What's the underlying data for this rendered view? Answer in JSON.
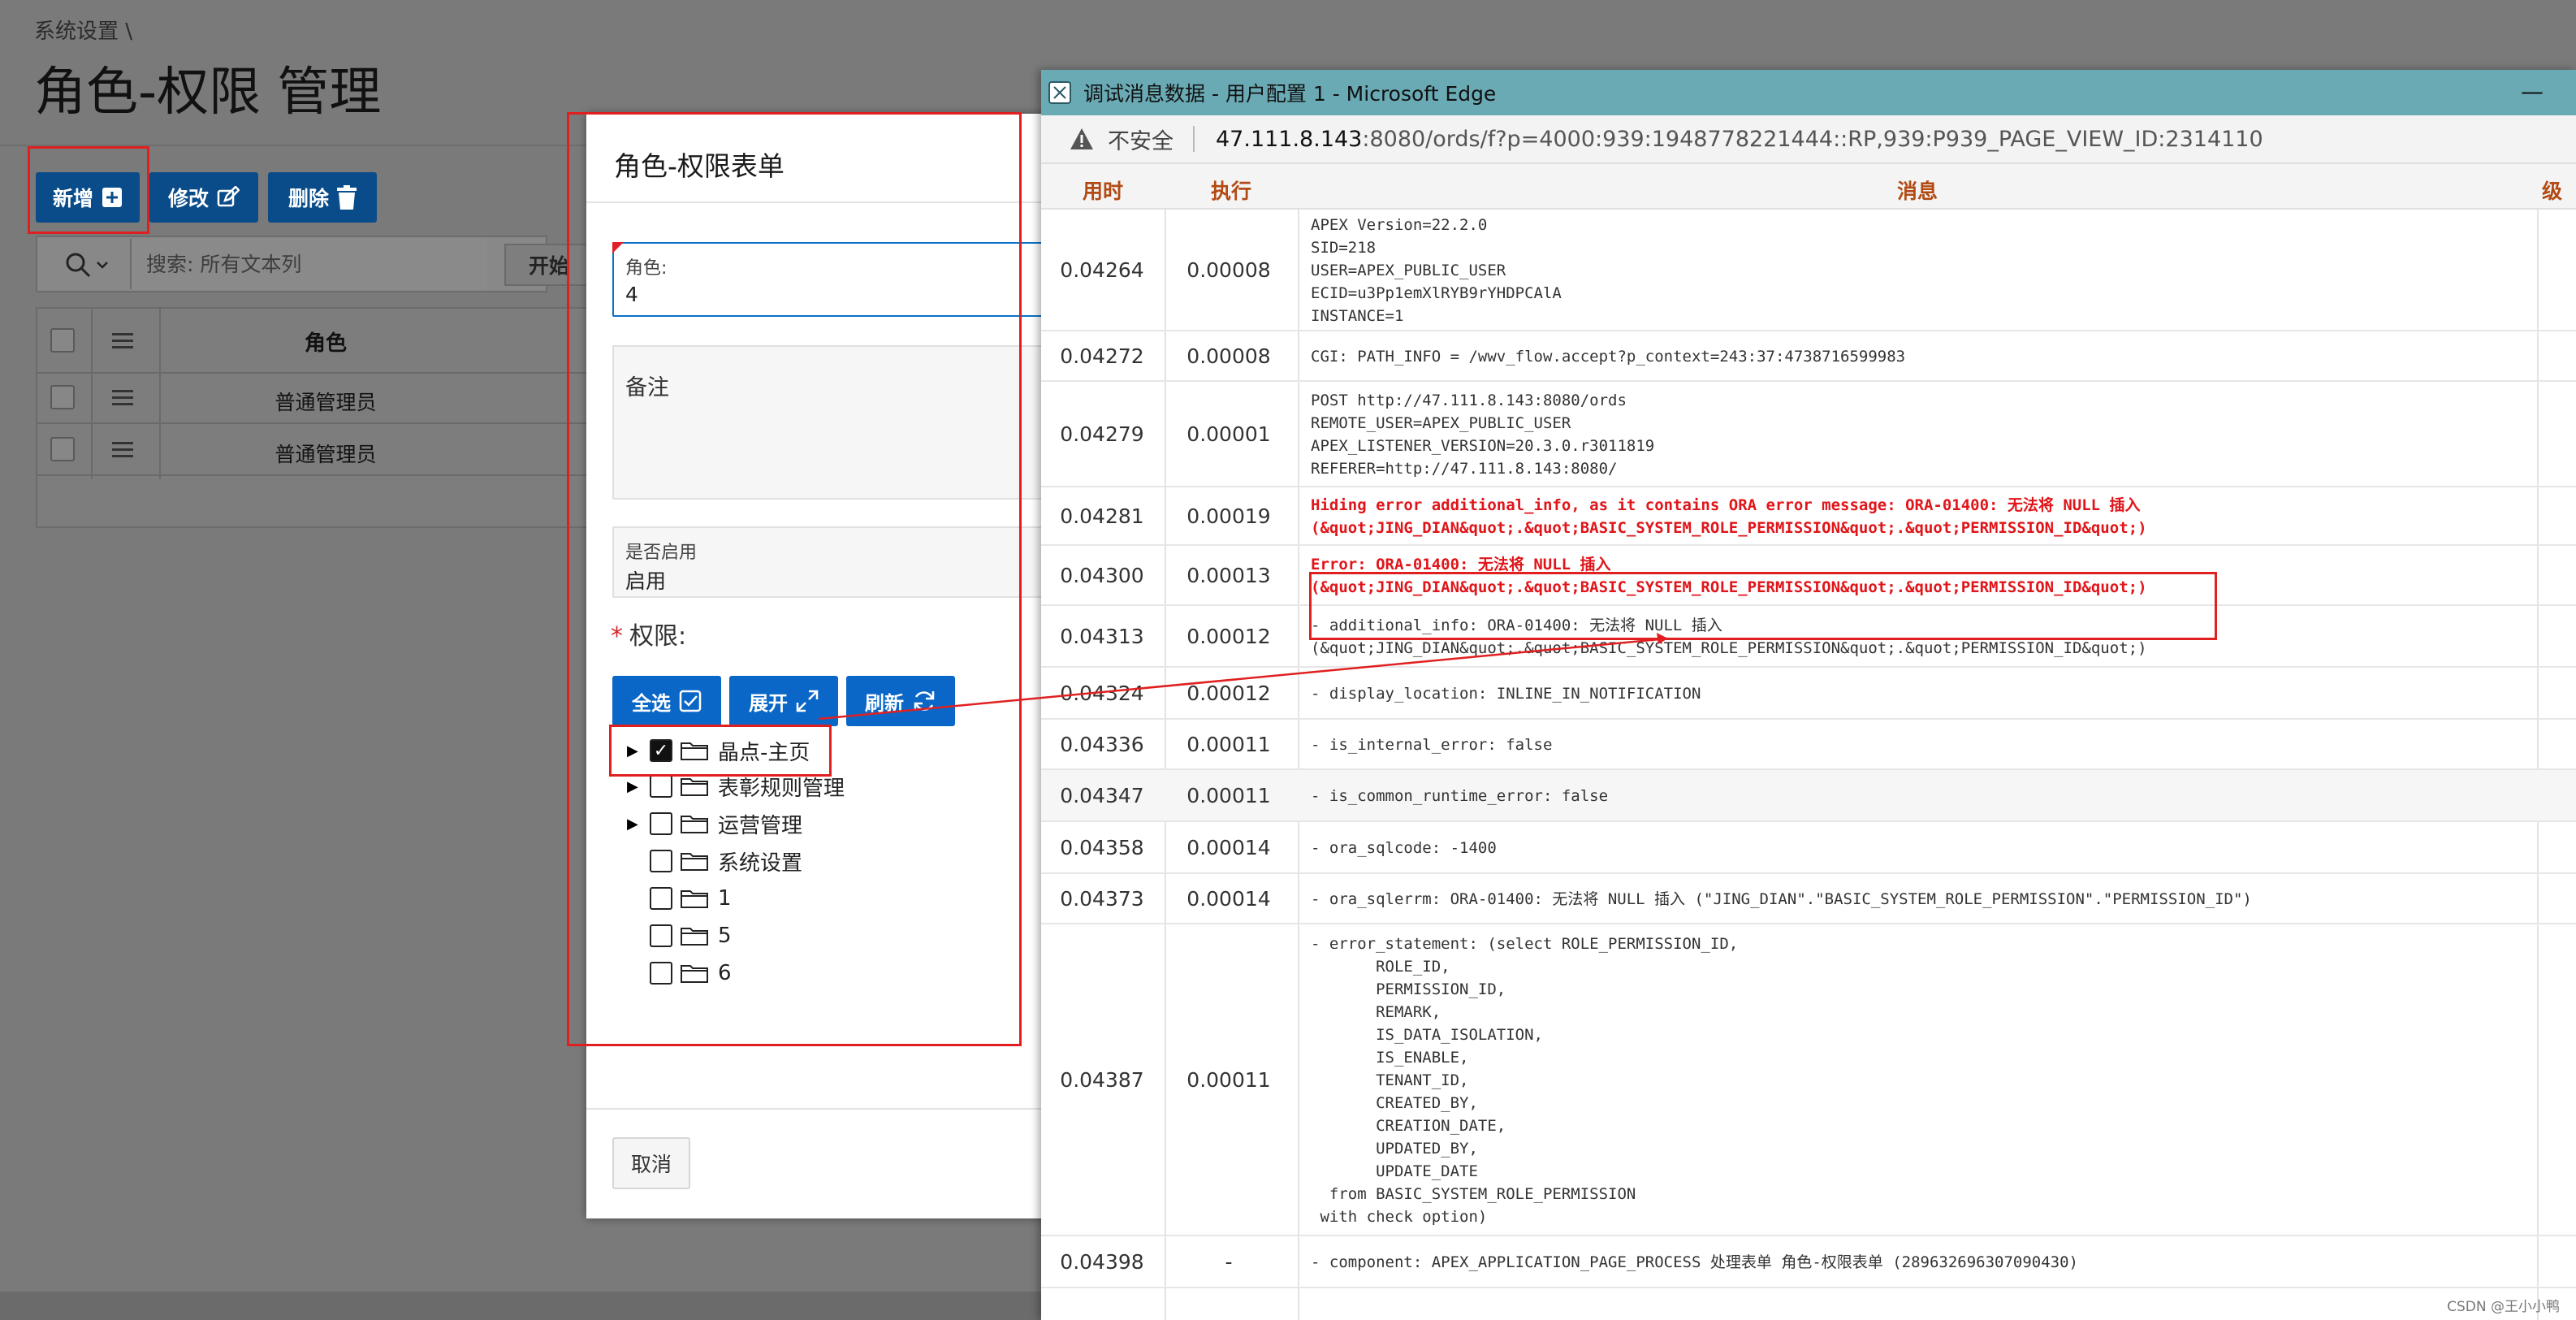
{
  "page": {
    "breadcrumb": "系统设置 \\",
    "title": "角色-权限 管理"
  },
  "toolbar": {
    "add_label": "新增",
    "edit_label": "修改",
    "delete_label": "删除"
  },
  "search": {
    "placeholder": "搜索: 所有文本列",
    "go_label": "开始"
  },
  "grid": {
    "column_role": "角色",
    "rows": [
      "普通管理员",
      "普通管理员"
    ]
  },
  "dialog": {
    "title": "角色-权限表单",
    "role_label": "角色:",
    "role_value": "4",
    "remark_label": "备注",
    "enabled_label": "是否启用",
    "enabled_value": "启用",
    "permission_label": "权限:",
    "select_all_label": "全选",
    "expand_label": "展开",
    "refresh_label": "刷新",
    "tree": [
      {
        "label": "晶点-主页",
        "checked": true,
        "expandable": true
      },
      {
        "label": "表彰规则管理",
        "checked": false,
        "expandable": true
      },
      {
        "label": "运营管理",
        "checked": false,
        "expandable": true
      },
      {
        "label": "系统设置",
        "checked": false,
        "expandable": false
      },
      {
        "label": "1",
        "checked": false,
        "expandable": false
      },
      {
        "label": "5",
        "checked": false,
        "expandable": false
      },
      {
        "label": "6",
        "checked": false,
        "expandable": false
      }
    ],
    "cancel_label": "取消"
  },
  "edge": {
    "window_title": "调试消息数据 - 用户配置 1 - Microsoft Edge",
    "insecure_label": "不安全",
    "url_host": "47.111.8.143",
    "url_rest": ":8080/ords/f?p=4000:939:1948778221444::RP,939:P939_PAGE_VIEW_ID:2314110",
    "columns": {
      "time": "用时",
      "exec": "执行",
      "message": "消息",
      "level": "级"
    },
    "rows": [
      {
        "time": "0.04264",
        "exec": "0.00008",
        "msg": "APEX Version=22.2.0\nSID=218\nUSER=APEX_PUBLIC_USER\nECID=u3Pp1emXlRYB9rYHDPCAlA\nINSTANCE=1",
        "err": false
      },
      {
        "time": "0.04272",
        "exec": "0.00008",
        "msg": "CGI: PATH_INFO = /wwv_flow.accept?p_context=243:37:4738716599983",
        "err": false
      },
      {
        "time": "0.04279",
        "exec": "0.00001",
        "msg": "POST http://47.111.8.143:8080/ords\nREMOTE_USER=APEX_PUBLIC_USER\nAPEX_LISTENER_VERSION=20.3.0.r3011819\nREFERER=http://47.111.8.143:8080/",
        "err": false
      },
      {
        "time": "0.04281",
        "exec": "0.00019",
        "msg": "Hiding error additional_info, as it contains ORA error message: ORA-01400: 无法将 NULL 插入\n(&quot;JING_DIAN&quot;.&quot;BASIC_SYSTEM_ROLE_PERMISSION&quot;.&quot;PERMISSION_ID&quot;)",
        "err": true
      },
      {
        "time": "0.04300",
        "exec": "0.00013",
        "msg": "Error: ORA-01400: 无法将 NULL 插入\n(&quot;JING_DIAN&quot;.&quot;BASIC_SYSTEM_ROLE_PERMISSION&quot;.&quot;PERMISSION_ID&quot;)",
        "err": true
      },
      {
        "time": "0.04313",
        "exec": "0.00012",
        "msg": "- additional_info: ORA-01400: 无法将 NULL 插入\n(&quot;JING_DIAN&quot;.&quot;BASIC_SYSTEM_ROLE_PERMISSION&quot;.&quot;PERMISSION_ID&quot;)",
        "err": false
      },
      {
        "time": "0.04324",
        "exec": "0.00012",
        "msg": "- display_location: INLINE_IN_NOTIFICATION",
        "err": false
      },
      {
        "time": "0.04336",
        "exec": "0.00011",
        "msg": "- is_internal_error: false",
        "err": false
      },
      {
        "time": "0.04347",
        "exec": "0.00011",
        "msg": "- is_common_runtime_error: false",
        "err": false
      },
      {
        "time": "0.04358",
        "exec": "0.00014",
        "msg": "- ora_sqlcode: -1400",
        "err": false
      },
      {
        "time": "0.04373",
        "exec": "0.00014",
        "msg": "- ora_sqlerrm: ORA-01400: 无法将 NULL 插入 (\"JING_DIAN\".\"BASIC_SYSTEM_ROLE_PERMISSION\".\"PERMISSION_ID\")",
        "err": false
      },
      {
        "time": "0.04387",
        "exec": "0.00011",
        "msg": "- error_statement: (select ROLE_PERMISSION_ID,\n       ROLE_ID,\n       PERMISSION_ID,\n       REMARK,\n       IS_DATA_ISOLATION,\n       IS_ENABLE,\n       TENANT_ID,\n       CREATED_BY,\n       CREATION_DATE,\n       UPDATED_BY,\n       UPDATE_DATE\n  from BASIC_SYSTEM_ROLE_PERMISSION\n with check option)",
        "err": false
      },
      {
        "time": "0.04398",
        "exec": "-",
        "msg": "- component: APEX_APPLICATION_PAGE_PROCESS 处理表单 角色-权限表单 (289632696307090430)",
        "err": false
      }
    ]
  },
  "watermark": "CSDN @王小小鸭",
  "colors": {
    "primary": "#0a4c8a",
    "dialog_button": "#0a67c7",
    "error_red": "#e0151a",
    "edge_title": "#6aaab5",
    "header_orange": "#b24a14"
  }
}
